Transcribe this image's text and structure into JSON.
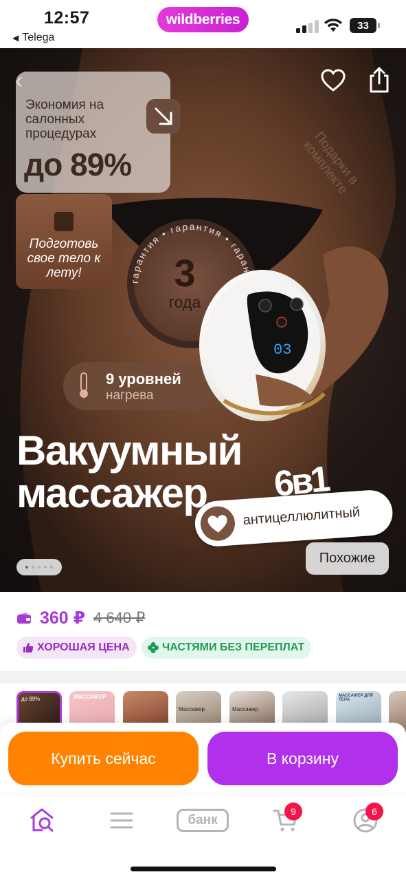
{
  "status_bar": {
    "time": "12:57",
    "back_app": "Telega",
    "brand_pill": "wildberries",
    "battery": "33"
  },
  "hero": {
    "savings_line": "Экономия на салонных процедурах",
    "savings_big": "до 89%",
    "prepare_text": "Подготовь свое тело к лету!",
    "warranty_ring": "гарантия • гарантия • гарантия •",
    "warranty_num": "3",
    "warranty_unit": "года",
    "gifts_text": "Подарки в комплекте",
    "heat_title": "9 уровней",
    "heat_sub": "нагрева",
    "device_display": "03",
    "title_line1": "Вакуумный",
    "title_line2": "массажер",
    "badge_6in1": "6в1",
    "anti_label": "антицеллюлитный",
    "similar_button": "Похожие",
    "carousel": {
      "count": 5,
      "active_index": 0
    }
  },
  "price": {
    "current": "360 ₽",
    "old": "4 640 ₽",
    "accent_color": "#a63ad8"
  },
  "badges": {
    "good_price": "ХОРОШАЯ ЦЕНА",
    "installments": "ЧАСТЯМИ БЕЗ ПЕРЕПЛАТ"
  },
  "thumbnails": [
    {
      "caption": "до 89%",
      "selected": true
    },
    {
      "caption": "МАССАЖЕР",
      "selected": false
    },
    {
      "caption": "",
      "selected": false
    },
    {
      "caption": "Массажер",
      "selected": false
    },
    {
      "caption": "Массажер",
      "selected": false
    },
    {
      "caption": "",
      "selected": false
    },
    {
      "caption": "МАССАЖЕР ДЛЯ ТЕЛА",
      "selected": false
    },
    {
      "caption": "",
      "selected": false
    }
  ],
  "actions": {
    "buy_now": "Купить сейчас",
    "add_to_cart": "В корзину",
    "buy_color": "#ff8200",
    "cart_color": "#b130ec"
  },
  "tab_bar": {
    "items": [
      {
        "icon": "home-search-icon",
        "active": true
      },
      {
        "icon": "menu-icon",
        "active": false
      },
      {
        "label": "банк",
        "icon": "bank-icon",
        "active": false
      },
      {
        "icon": "cart-icon",
        "badge": "9",
        "active": false
      },
      {
        "icon": "profile-icon",
        "badge": "6",
        "active": false
      }
    ]
  }
}
